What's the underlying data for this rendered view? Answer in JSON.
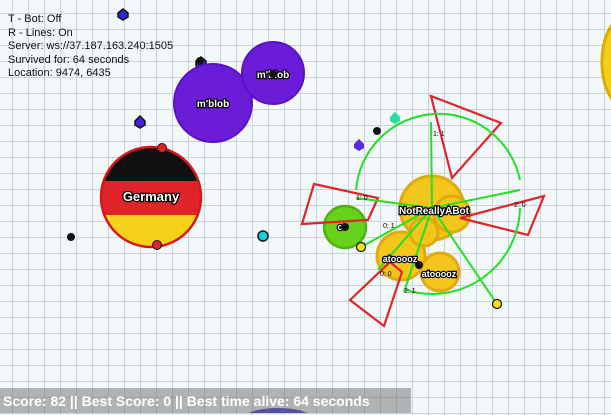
{
  "hud": {
    "bot": "T - Bot: Off",
    "lines": "R - Lines: On",
    "server": "Server: ws://37.187.163.240:1505",
    "survived": "Survived for: 64 seconds",
    "location": "Location: 9474, 6435"
  },
  "score_bar": "Score: 82 || Best Score: 0 || Best time alive: 64 seconds",
  "cells": {
    "germany": "Germany",
    "mblob_large": "m'blob",
    "mblob_small": "m'blob",
    "player_main": "NotReallyABot",
    "green_cell": "c",
    "atooooz_a": "atooooz",
    "atooooz_b": "atooooz"
  },
  "line_labels": {
    "top": "1: 1",
    "left": "1: 0",
    "right": "2: 0",
    "mid": "0: 1",
    "lower": "0: 0",
    "bottom": "2: 1"
  },
  "colors": {
    "purple": "#6a1cd8",
    "yellow": "#f4c61c",
    "green": "#66d21a",
    "red": "#e0242a",
    "line_green": "#22e022"
  }
}
